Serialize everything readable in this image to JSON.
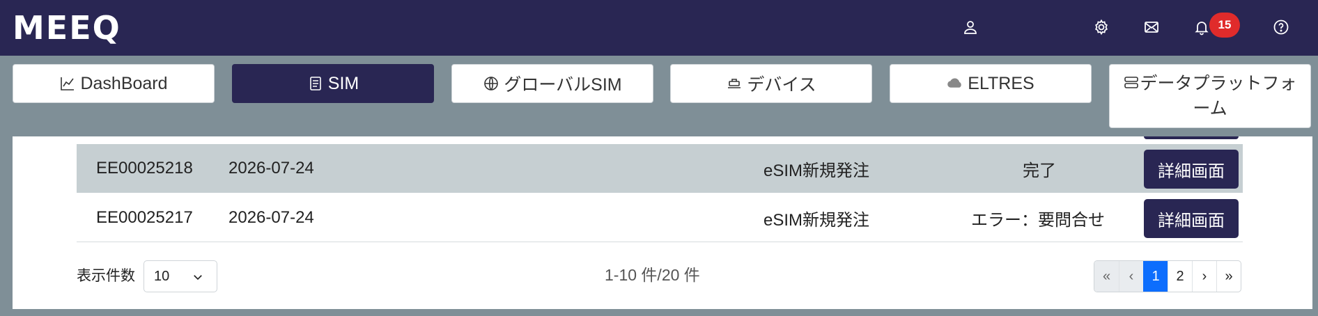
{
  "header": {
    "logo": "MEEQ",
    "notification_count": "15",
    "icons": [
      "user-icon",
      "gear-icon",
      "mail-icon",
      "bell-icon",
      "help-icon"
    ]
  },
  "nav": {
    "items": [
      {
        "label": "DashBoard",
        "icon": "chart-icon"
      },
      {
        "label": "SIM",
        "icon": "document-icon",
        "active": true
      },
      {
        "label": "グローバルSIM",
        "icon": "globe-icon"
      },
      {
        "label": "デバイス",
        "icon": "device-icon"
      },
      {
        "label": "ELTRES",
        "icon": "cloud-icon"
      },
      {
        "label": "データプラットフォーム",
        "icon": "server-icon"
      }
    ]
  },
  "table": {
    "rows": [
      {
        "id": "EE00025218",
        "date": "2026-07-24",
        "type": "eSIM新規発注",
        "status": "完了",
        "action": "詳細画面"
      },
      {
        "id": "EE00025217",
        "date": "2026-07-24",
        "type": "eSIM新規発注",
        "status": "エラー：要問合せ",
        "action": "詳細画面"
      }
    ]
  },
  "footer": {
    "per_page_label": "表示件数",
    "per_page_value": "10",
    "range_text": "1-10 件/20 件",
    "pager": {
      "first": "«",
      "prev": "‹",
      "page1": "1",
      "page2": "2",
      "next": "›",
      "last": "»"
    }
  },
  "colors": {
    "primary": "#292653",
    "background": "#7f8f97",
    "badge": "#e02b2b",
    "active_page": "#0d6efd"
  }
}
